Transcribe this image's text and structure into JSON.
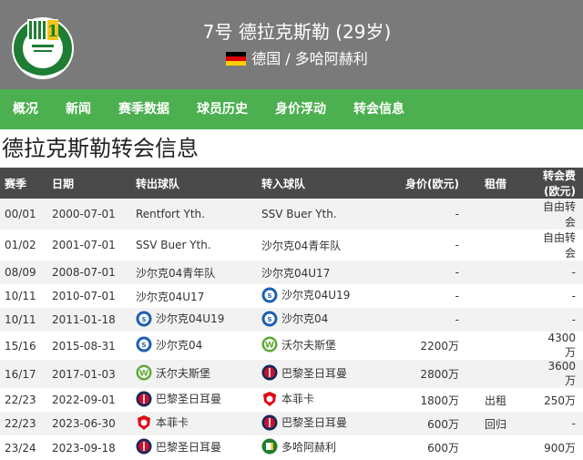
{
  "header": {
    "player_title": "7号 德拉克斯勒 (29岁)",
    "subline": "德国 / 多哈阿赫利",
    "logo_icon": "al-ahli-doha-crest-icon",
    "flag_icon": "germany-flag-icon",
    "colors": {
      "header_bg": "#7a7a7a",
      "nav_bg": "#4caf50",
      "table_head_bg": "#4a4a4a"
    }
  },
  "nav": {
    "items": [
      "概况",
      "新闻",
      "赛季数据",
      "球员历史",
      "身价浮动",
      "转会信息"
    ]
  },
  "page_title": "德拉克斯勒转会信息",
  "table": {
    "headers": {
      "season": "赛季",
      "date": "日期",
      "from": "转出球队",
      "to": "转入球队",
      "value": "身价(欧元)",
      "loan": "租借",
      "fee": "转会费(欧元)"
    },
    "rows": [
      {
        "season": "00/01",
        "date": "2000-07-01",
        "from": "Rentfort Yth.",
        "from_icon": "",
        "to": "SSV Buer Yth.",
        "to_icon": "",
        "value": "-",
        "loan": "",
        "fee": "自由转会"
      },
      {
        "season": "01/02",
        "date": "2001-07-01",
        "from": "SSV Buer Yth.",
        "from_icon": "",
        "to": "沙尔克04青年队",
        "to_icon": "",
        "value": "-",
        "loan": "",
        "fee": "自由转会"
      },
      {
        "season": "08/09",
        "date": "2008-07-01",
        "from": "沙尔克04青年队",
        "from_icon": "",
        "to": "沙尔克04U17",
        "to_icon": "",
        "value": "-",
        "loan": "",
        "fee": "-"
      },
      {
        "season": "10/11",
        "date": "2010-07-01",
        "from": "沙尔克04U17",
        "from_icon": "",
        "to": "沙尔克04U19",
        "to_icon": "schalke-crest-icon",
        "value": "-",
        "loan": "",
        "fee": "-"
      },
      {
        "season": "10/11",
        "date": "2011-01-18",
        "from": "沙尔克04U19",
        "from_icon": "schalke-crest-icon",
        "to": "沙尔克04",
        "to_icon": "schalke-crest-icon",
        "value": "-",
        "loan": "",
        "fee": "-"
      },
      {
        "season": "15/16",
        "date": "2015-08-31",
        "from": "沙尔克04",
        "from_icon": "schalke-crest-icon",
        "to": "沃尔夫斯堡",
        "to_icon": "wolfsburg-crest-icon",
        "value": "2200万",
        "loan": "",
        "fee": "4300万"
      },
      {
        "season": "16/17",
        "date": "2017-01-03",
        "from": "沃尔夫斯堡",
        "from_icon": "wolfsburg-crest-icon",
        "to": "巴黎圣日耳曼",
        "to_icon": "psg-crest-icon",
        "value": "2800万",
        "loan": "",
        "fee": "3600万"
      },
      {
        "season": "22/23",
        "date": "2022-09-01",
        "from": "巴黎圣日耳曼",
        "from_icon": "psg-crest-icon",
        "to": "本菲卡",
        "to_icon": "benfica-crest-icon",
        "value": "1800万",
        "loan": "出租",
        "fee": "250万"
      },
      {
        "season": "22/23",
        "date": "2023-06-30",
        "from": "本菲卡",
        "from_icon": "benfica-crest-icon",
        "to": "巴黎圣日耳曼",
        "to_icon": "psg-crest-icon",
        "value": "600万",
        "loan": "回归",
        "fee": "-"
      },
      {
        "season": "23/24",
        "date": "2023-09-18",
        "from": "巴黎圣日耳曼",
        "from_icon": "psg-crest-icon",
        "to": "多哈阿赫利",
        "to_icon": "al-ahli-doha-crest-icon",
        "value": "600万",
        "loan": "",
        "fee": "900万"
      }
    ]
  }
}
